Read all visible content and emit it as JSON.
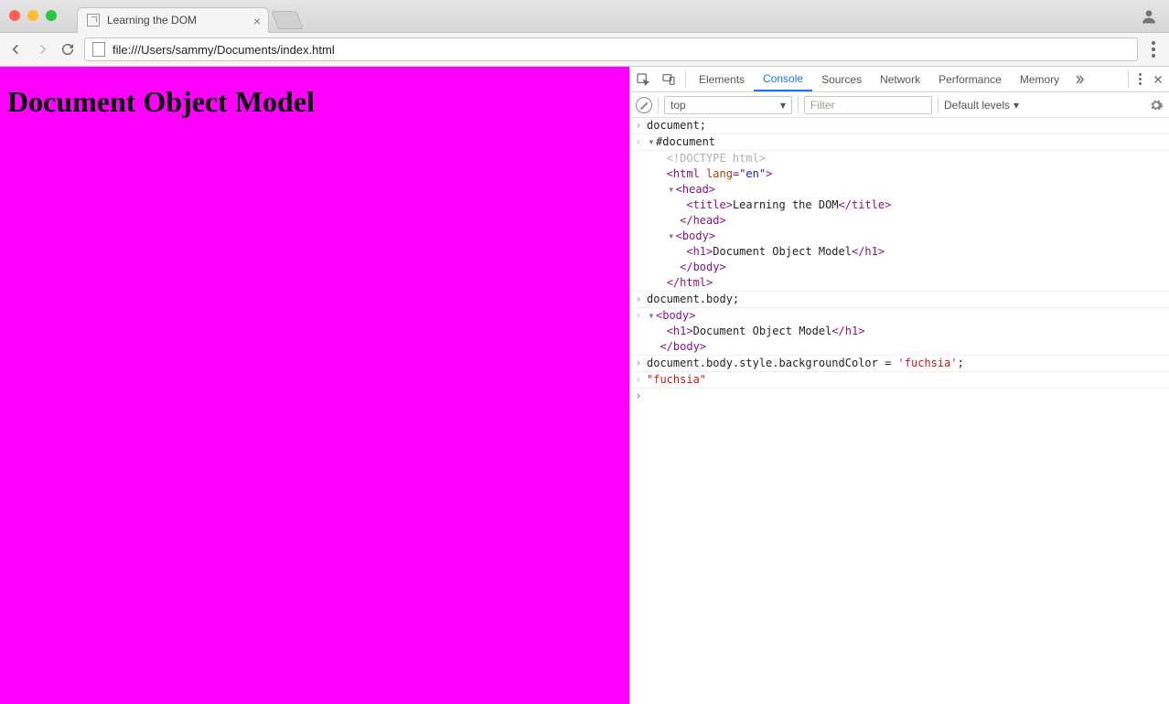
{
  "tab": {
    "title": "Learning the DOM"
  },
  "address": {
    "url": "file:///Users/sammy/Documents/index.html"
  },
  "page": {
    "h1": "Document Object Model",
    "background": "#ff00ff"
  },
  "devtools": {
    "tabs": [
      "Elements",
      "Console",
      "Sources",
      "Network",
      "Performance",
      "Memory"
    ],
    "active_tab": "Console",
    "toolbar": {
      "context": "top",
      "filter_placeholder": "Filter",
      "levels": "Default levels"
    },
    "html": {
      "lang": "en",
      "title": "Learning the DOM",
      "h1": "Document Object Model"
    },
    "console": [
      {
        "kind": "input",
        "text": "document;"
      },
      {
        "kind": "output",
        "text": "#document"
      },
      {
        "kind": "doctype",
        "text": "<!DOCTYPE html>"
      },
      {
        "kind": "input",
        "text": "document.body;"
      },
      {
        "kind": "input",
        "pre": "document.body.style.backgroundColor = ",
        "str": "'fuchsia'",
        "post": ";"
      },
      {
        "kind": "output",
        "text": "\"fuchsia\""
      }
    ]
  }
}
